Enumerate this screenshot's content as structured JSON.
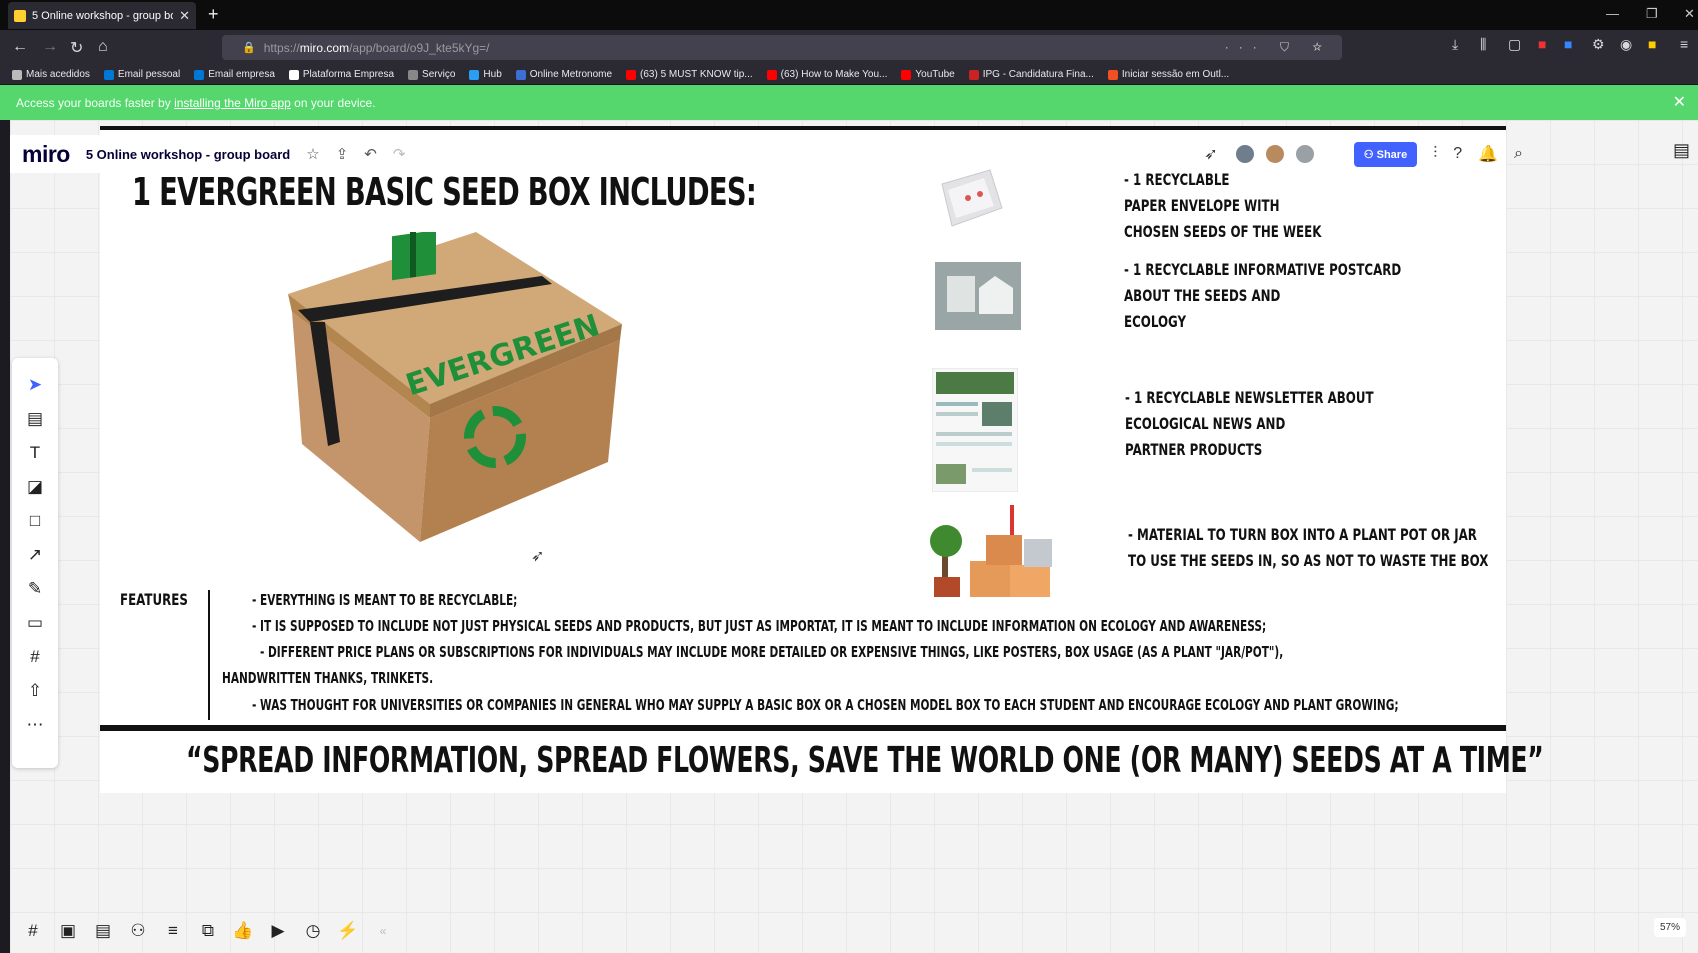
{
  "browser": {
    "tab_title": "5 Online workshop - group bo",
    "url_prefix": "https://",
    "url_domain": "miro.com",
    "url_path": "/app/board/o9J_kte5kYg=/",
    "bookmarks": [
      {
        "label": "Mais acedidos",
        "color": "#bbbbbb"
      },
      {
        "label": "Email pessoal",
        "color": "#0078d4"
      },
      {
        "label": "Email empresa",
        "color": "#0078d4"
      },
      {
        "label": "Plataforma Empresa",
        "color": "#ffffff"
      },
      {
        "label": "Serviço",
        "color": "#888888"
      },
      {
        "label": "Hub",
        "color": "#2a9df4"
      },
      {
        "label": "Online Metronome",
        "color": "#3b6fd6"
      },
      {
        "label": "(63) 5 MUST KNOW tip...",
        "color": "#ff0000"
      },
      {
        "label": "(63) How to Make You...",
        "color": "#ff0000"
      },
      {
        "label": "YouTube",
        "color": "#ff0000"
      },
      {
        "label": "IPG - Candidatura Fina...",
        "color": "#cc2222"
      },
      {
        "label": "Iniciar sessão em Outl...",
        "color": "#f25022"
      }
    ]
  },
  "banner": {
    "prefix": "Access your boards faster by ",
    "link": "installing the Miro app",
    "suffix": " on your device."
  },
  "miro": {
    "logo": "miro",
    "board_name": "5 Online workshop - group board",
    "share_label": "Share",
    "zoom": "57%"
  },
  "content": {
    "headline": "1 EVERGREEN BASIC SEED  BOX INCLUDES:",
    "box_brand": "EVERGREEN",
    "items": [
      {
        "text": "- 1 RECYCLABLE\nPAPER ENVELOPE WITH\nCHOSEN SEEDS OF THE WEEK"
      },
      {
        "text": "- 1 RECYCLABLE INFORMATIVE POSTCARD\nABOUT THE SEEDS AND\nECOLOGY"
      },
      {
        "text": "- 1 RECYCLABLE NEWSLETTER ABOUT\nECOLOGICAL NEWS AND\nPARTNER PRODUCTS"
      },
      {
        "text": "- MATERIAL TO TURN BOX INTO A PLANT POT OR JAR\nTO USE THE SEEDS IN, SO AS NOT TO WASTE THE BOX"
      }
    ],
    "features_label": "FEATURES",
    "features": [
      "- EVERYTHING IS MEANT TO BE RECYCLABLE;",
      "- IT IS SUPPOSED TO INCLUDE NOT JUST PHYSICAL SEEDS AND PRODUCTS, BUT JUST AS IMPORTAT, IT IS MEANT TO INCLUDE INFORMATION ON ECOLOGY AND AWARENESS;",
      "- DIFFERENT PRICE PLANS OR SUBSCRIPTIONS FOR INDIVIDUALS MAY INCLUDE MORE DETAILED OR EXPENSIVE THINGS, LIKE POSTERS, BOX USAGE (AS A PLANT \"JAR/POT\"),",
      "HANDWRITTEN THANKS, TRINKETS.",
      "- WAS THOUGHT FOR UNIVERSITIES OR COMPANIES IN GENERAL WHO MAY SUPPLY A BASIC BOX OR A CHOSEN MODEL BOX TO EACH STUDENT AND ENCOURAGE ECOLOGY AND PLANT GROWING;"
    ],
    "quote": "“SPREAD INFORMATION, SPREAD FLOWERS, SAVE THE WORLD ONE (OR MANY) SEEDS AT A TIME”"
  },
  "colors": {
    "banner": "#55d76e",
    "share": "#4262ff",
    "box": "#c89a68",
    "brand_green": "#1f8f3a"
  }
}
